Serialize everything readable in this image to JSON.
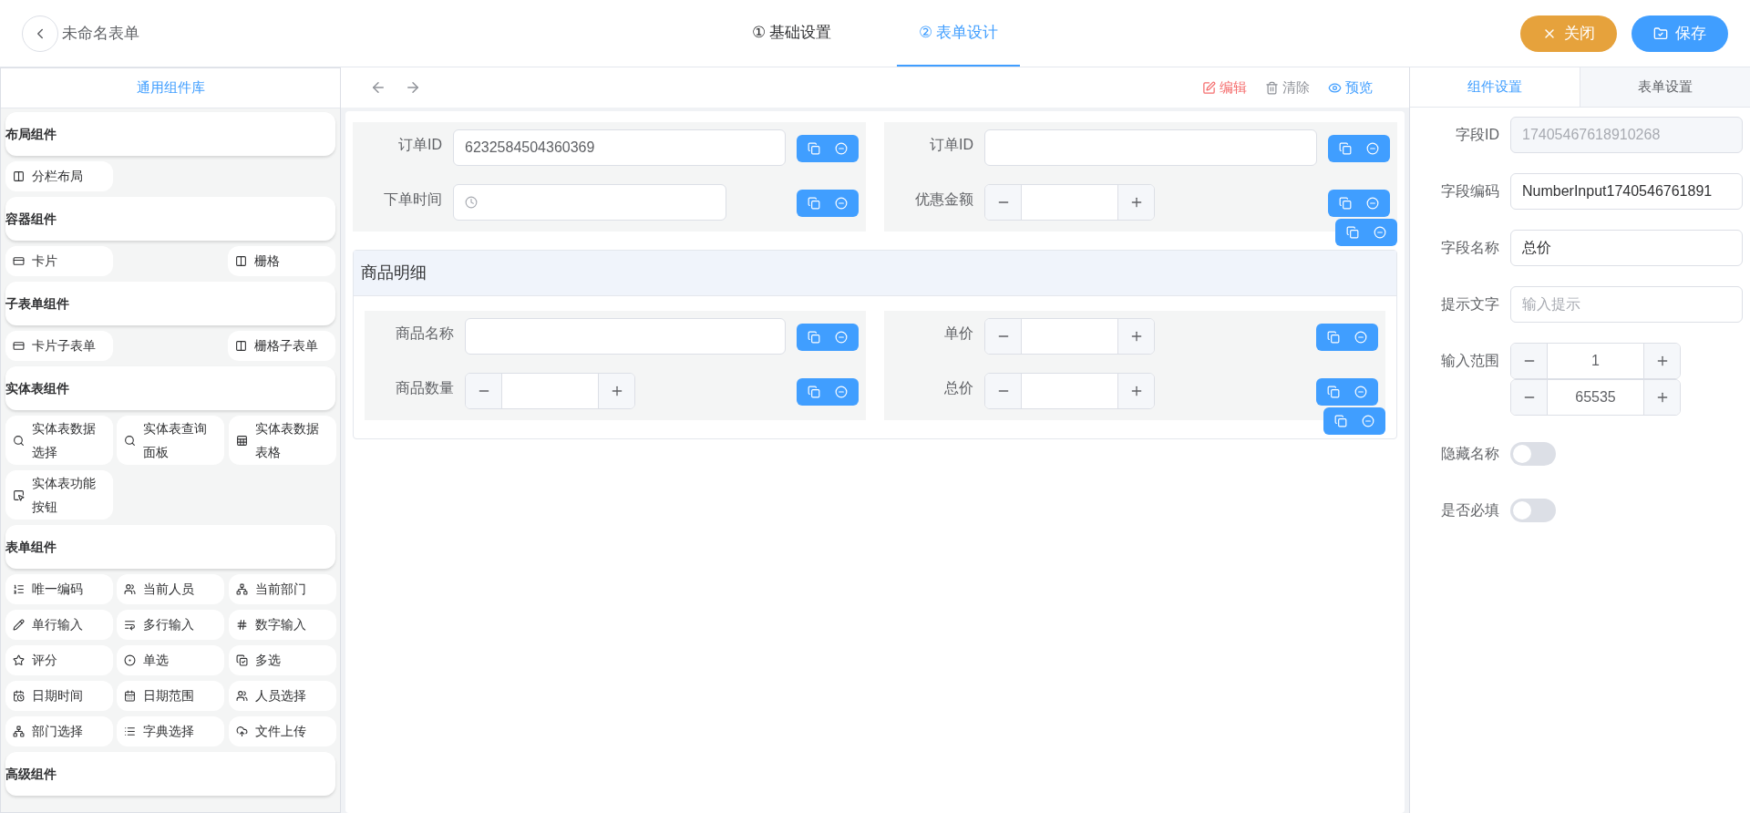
{
  "header": {
    "title": "未命名表单",
    "steps": [
      {
        "number": "①",
        "label": "基础设置",
        "selected": false
      },
      {
        "number": "②",
        "label": "表单设计",
        "selected": true
      }
    ],
    "buttons": [
      {
        "kind": "close",
        "label": "关闭"
      },
      {
        "kind": "save",
        "label": "保存"
      }
    ]
  },
  "library": {
    "title": "通用组件库",
    "groups": [
      {
        "title": "布局组件",
        "items": [
          "分栏布局"
        ]
      },
      {
        "title": "容器组件",
        "items": [
          "卡片",
          "栅格"
        ]
      },
      {
        "title": "子表单组件",
        "items": [
          "卡片子表单",
          "栅格子表单"
        ]
      },
      {
        "title": "实体表组件",
        "items": [
          "实体表数据选择",
          "实体表查询面板",
          "实体表数据表格",
          "实体表功能按钮"
        ]
      },
      {
        "title": "表单组件",
        "items": [
          "唯一编码",
          "当前人员",
          "当前部门",
          "单行输入",
          "多行输入",
          "数字输入",
          "评分",
          "单选",
          "多选",
          "日期时间",
          "日期范围",
          "人员选择",
          "部门选择",
          "字典选择",
          "文件上传"
        ]
      },
      {
        "title": "高级组件"
      }
    ]
  },
  "toolbar": {
    "actions": [
      {
        "kind": "edit",
        "label": "编辑"
      },
      {
        "kind": "clear",
        "label": "清除"
      },
      {
        "kind": "preview",
        "label": "预览"
      }
    ]
  },
  "canvas": {
    "rows": [
      {
        "fields": [
          {
            "label": "订单ID",
            "kind": "text",
            "value": "6232584504360369"
          },
          {
            "label": "订单ID",
            "kind": "text"
          }
        ]
      },
      {
        "fields": [
          {
            "label": "下单时间",
            "kind": "time"
          },
          {
            "label": "优惠金额",
            "kind": "number"
          }
        ]
      }
    ],
    "subform": {
      "title": "商品明细",
      "rows": [
        {
          "fields": [
            {
              "label": "商品名称",
              "kind": "text"
            },
            {
              "label": "单价",
              "kind": "number"
            }
          ]
        },
        {
          "fields": [
            {
              "label": "商品数量",
              "kind": "number"
            },
            {
              "label": "总价",
              "kind": "number"
            }
          ]
        }
      ]
    }
  },
  "settings": {
    "tabs": [
      {
        "label": "组件设置",
        "selected": true
      },
      {
        "label": "表单设置",
        "selected": false
      }
    ],
    "fields": [
      {
        "label": "字段ID",
        "kind": "text",
        "value": "17405467618910268",
        "disabled": true
      },
      {
        "label": "字段编码",
        "kind": "text",
        "value": "NumberInput1740546761891",
        "disabled": false
      },
      {
        "label": "字段名称",
        "kind": "text",
        "value": "总价",
        "disabled": false
      },
      {
        "label": "提示文字",
        "kind": "text",
        "placeholder": "输入提示",
        "disabled": false
      },
      {
        "label": "输入范围",
        "kind": "range",
        "values": [
          "1",
          "65535"
        ]
      },
      {
        "label": "隐藏名称",
        "kind": "switch",
        "on": false
      },
      {
        "label": "是否必填",
        "kind": "switch",
        "on": false
      }
    ]
  }
}
